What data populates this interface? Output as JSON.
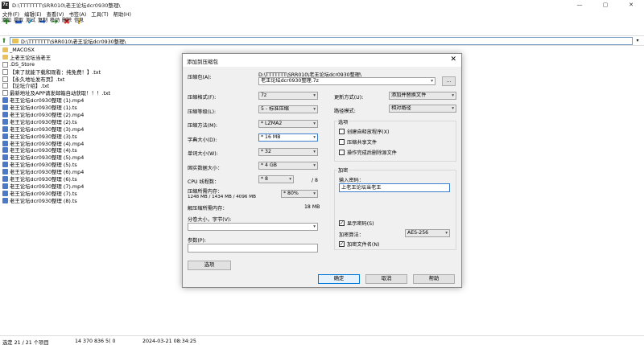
{
  "window": {
    "title": "D:\\TTTTTTT\\SRR010\\老王论坛dcr0930整理\\",
    "controls": [
      "—",
      "▢",
      "✕"
    ]
  },
  "menu": [
    "文件(F)",
    "编辑(E)",
    "查看(V)",
    "书签(A)",
    "工具(T)",
    "帮助(H)"
  ],
  "toolbar": [
    {
      "label": "添加",
      "icon": "add-icon",
      "glyph": "✚",
      "color": "#2e9c2e"
    },
    {
      "label": "提取",
      "icon": "extract-icon",
      "glyph": "▬",
      "color": "#2b5fcf"
    },
    {
      "label": "测试",
      "icon": "test-icon",
      "glyph": "✔",
      "color": "#1f9fd0"
    },
    {
      "label": "复制",
      "icon": "copy-icon",
      "glyph": "➡",
      "color": "#2b5fcf"
    },
    {
      "label": "移动",
      "icon": "move-icon",
      "glyph": "➔",
      "color": "#2e9c2e"
    },
    {
      "label": "删除",
      "icon": "delete-icon",
      "glyph": "✖",
      "color": "#d22"
    },
    {
      "label": "信息",
      "icon": "info-icon",
      "glyph": "i",
      "color": "#c9a000"
    }
  ],
  "address": {
    "path": "D:\\TTTTTTT\\SRR010\\老王论坛dcr0930整理\\"
  },
  "files": [
    {
      "name": "_MACOSX",
      "type": "folder"
    },
    {
      "name": "上老王论坛当老王",
      "type": "folder"
    },
    {
      "name": ".DS_Store",
      "type": "doc"
    },
    {
      "name": "【来了就能下载和观看：纯免费！】.txt",
      "type": "doc"
    },
    {
      "name": "【永久地址发布页】.txt",
      "type": "doc"
    },
    {
      "name": "【论坛介绍】.txt",
      "type": "doc"
    },
    {
      "name": "最新地址及APP请发邮箱自动获取！！！.txt",
      "type": "doc"
    },
    {
      "name": "老王论坛dcr0930整理 (1).mp4",
      "type": "ts"
    },
    {
      "name": "老王论坛dcr0930整理 (1).ts",
      "type": "ts"
    },
    {
      "name": "老王论坛dcr0930整理 (2).mp4",
      "type": "ts"
    },
    {
      "name": "老王论坛dcr0930整理 (2).ts",
      "type": "ts"
    },
    {
      "name": "老王论坛dcr0930整理 (3).mp4",
      "type": "ts"
    },
    {
      "name": "老王论坛dcr0930整理 (3).ts",
      "type": "ts"
    },
    {
      "name": "老王论坛dcr0930整理 (4).mp4",
      "type": "ts"
    },
    {
      "name": "老王论坛dcr0930整理 (4).ts",
      "type": "ts"
    },
    {
      "name": "老王论坛dcr0930整理 (5).mp4",
      "type": "ts"
    },
    {
      "name": "老王论坛dcr0930整理 (5).ts",
      "type": "ts"
    },
    {
      "name": "老王论坛dcr0930整理 (6).mp4",
      "type": "ts"
    },
    {
      "name": "老王论坛dcr0930整理 (6).ts",
      "type": "ts"
    },
    {
      "name": "老王论坛dcr0930整理 (7).mp4",
      "type": "ts"
    },
    {
      "name": "老王论坛dcr0930整理 (7).ts",
      "type": "ts"
    },
    {
      "name": "老王论坛dcr0930整理 (8).ts",
      "type": "ts"
    }
  ],
  "status": {
    "selected": "选定 21 / 21 个项目",
    "size": "14 370 836 5( 0",
    "date": "2024-03-21 08:34:25"
  },
  "dialog": {
    "title": "添加到压缩包",
    "archive_label": "压缩包(A):",
    "archive_dir": "D:\\TTTTTTT\\SRR010\\老王论坛dcr0930整理\\",
    "archive_name": "老王论坛dcr0930整理.7z",
    "browse": "...",
    "format_label": "压缩格式(F):",
    "format_value": "7z",
    "level_label": "压缩等级(L):",
    "level_value": "5 - 标准压缩",
    "method_label": "压缩方法(M):",
    "method_value": "* LZMA2",
    "dict_label": "字典大小(D):",
    "dict_value": "* 16 MB",
    "word_label": "单词大小(W):",
    "word_value": "* 32",
    "solid_label": "固实数据大小：",
    "solid_value": "* 4 GB",
    "threads_label": "CPU 线程数：",
    "threads_value": "* 8",
    "threads_max": "/ 8",
    "memory_label": "压缩所需内存：",
    "memory_value": "1248 MB / 1434 MB / 4096 MB",
    "memory_pct": "* 80%",
    "decomp_label": "解压缩所需内存：",
    "decomp_value": "18 MB",
    "split_label": "分卷大小，字节(V):",
    "params_label": "参数(P):",
    "options_button": "选项",
    "update_label": "更新方式(U):",
    "update_value": "添加并替换文件",
    "path_label": "路径模式:",
    "path_value": "相对路径",
    "options_group": "选项",
    "opt_sfx": "创建自释放程序(X)",
    "opt_shared": "压缩共享文件",
    "opt_delete": "操作完成后删除源文件",
    "encrypt_group": "加密",
    "password_label": "输入密码：",
    "password_value": "上老王论坛当老王",
    "show_password": "显示密码(S)",
    "encrypt_method_label": "加密算法：",
    "encrypt_method_value": "AES-256",
    "encrypt_names": "加密文件名(N)",
    "ok": "确定",
    "cancel": "取消",
    "help": "帮助"
  }
}
